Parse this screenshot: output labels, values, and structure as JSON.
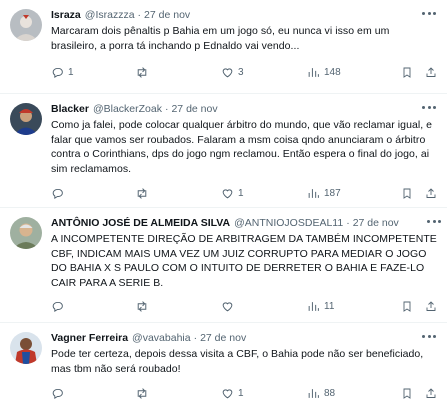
{
  "tweets": [
    {
      "name": "Israza",
      "handle": "@Israzzza",
      "date": "27 de nov",
      "text": "Marcaram dois pênaltis p Bahia em um jogo só, eu nunca vi isso em um brasileiro, a porra tá inchando p Ednaldo vai vendo...",
      "replies": "1",
      "retweets": "",
      "likes": "3",
      "views": "148"
    },
    {
      "name": "Blacker",
      "handle": "@BlackerZoak",
      "date": "27 de nov",
      "text": "Como ja falei, pode colocar qualquer árbitro do mundo, que vão reclamar igual, e falar que vamos ser roubados. Falaram a msm coisa qndo anunciaram o árbitro contra o Corinthians, dps do jogo ngm reclamou. Então espera o final do jogo, ai sim reclamamos.",
      "replies": "",
      "retweets": "",
      "likes": "1",
      "views": "187"
    },
    {
      "name": "ANTÔNIO JOSÉ DE ALMEIDA SILVA",
      "handle": "@ANTNIOJOSDEAL11",
      "date": "27 de nov",
      "text": "A INCOMPETENTE DIREÇÃO DE ARBITRAGEM DA TAMBÉM INCOMPETENTE CBF, INDICAM MAIS UMA VEZ UM JUIZ CORRUPTO PARA MEDIAR O JOGO DO BAHIA X S PAULO COM O INTUITO DE DERRETER O BAHIA E FAZE-LO CAIR PARA A SERIE B.",
      "replies": "",
      "retweets": "",
      "likes": "",
      "views": "11"
    },
    {
      "name": "Vagner Ferreira",
      "handle": "@vavabahia",
      "date": "27 de nov",
      "text": "Pode ter certeza, depois dessa visita a CBF, o Bahia pode não ser beneficiado, mas tbm não será roubado!",
      "replies": "",
      "retweets": "",
      "likes": "1",
      "views": "88"
    }
  ],
  "icons": {
    "reply": "reply-icon",
    "retweet": "retweet-icon",
    "like": "heart-icon",
    "views": "views-icon",
    "bookmark": "bookmark-icon",
    "share": "share-icon",
    "more": "more-icon"
  },
  "colors": {
    "text": "#0f1419",
    "secondary": "#536471",
    "divider": "#eff3f4"
  }
}
